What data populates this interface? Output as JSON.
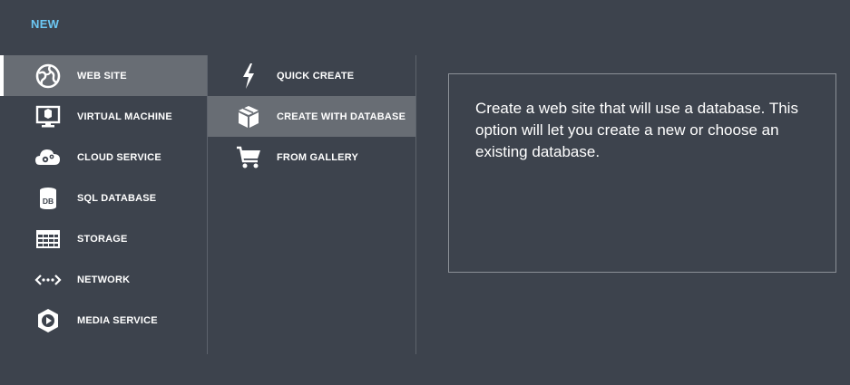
{
  "dialog": {
    "title": "NEW"
  },
  "services": [
    {
      "label": "WEB SITE",
      "icon": "web-site-icon",
      "selected": true
    },
    {
      "label": "VIRTUAL MACHINE",
      "icon": "virtual-machine-icon",
      "selected": false
    },
    {
      "label": "CLOUD SERVICE",
      "icon": "cloud-service-icon",
      "selected": false
    },
    {
      "label": "SQL DATABASE",
      "icon": "sql-database-icon",
      "selected": false
    },
    {
      "label": "STORAGE",
      "icon": "storage-icon",
      "selected": false
    },
    {
      "label": "NETWORK",
      "icon": "network-icon",
      "selected": false
    },
    {
      "label": "MEDIA SERVICE",
      "icon": "media-service-icon",
      "selected": false
    }
  ],
  "options": [
    {
      "label": "QUICK CREATE",
      "icon": "lightning-icon",
      "selected": false
    },
    {
      "label": "CREATE WITH DATABASE",
      "icon": "box-icon",
      "selected": true
    },
    {
      "label": "FROM GALLERY",
      "icon": "cart-icon",
      "selected": false
    }
  ],
  "description": {
    "text": "Create a web site that will use a database. This option will let you create a new or choose an existing database."
  },
  "colors": {
    "background": "#3d434d",
    "selected_background": "#686d74",
    "title_accent": "#6cc8f4",
    "divider": "#5d636c",
    "box_border": "#8b9097"
  }
}
